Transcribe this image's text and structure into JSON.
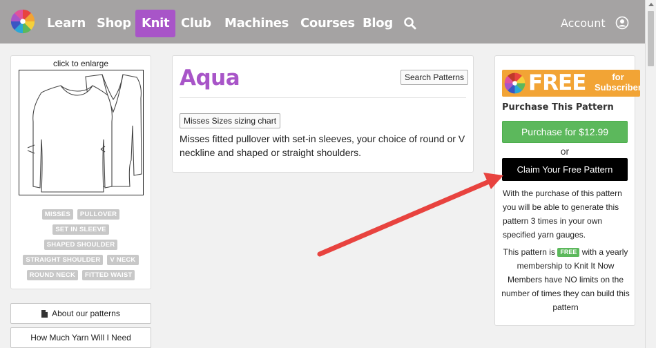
{
  "nav": {
    "items": [
      "Learn",
      "Shop",
      "Knit",
      "Club",
      "Machines",
      "Courses",
      "Blog"
    ],
    "active": "Knit",
    "account_label": "Account"
  },
  "sidebar": {
    "enlarge_label": "click to enlarge",
    "tags": [
      [
        "MISSES",
        "PULLOVER"
      ],
      [
        "SET IN SLEEVE"
      ],
      [
        "SHAPED SHOULDER"
      ],
      [
        "STRAIGHT SHOULDER",
        "V NECK"
      ],
      [
        "ROUND NECK",
        "FITTED WAIST"
      ]
    ],
    "about_label": "About our patterns",
    "yarn_label": "How Much Yarn Will I Need"
  },
  "pattern": {
    "title": "Aqua",
    "search_button": "Search Patterns",
    "sizing_button": "Misses Sizes sizing chart",
    "description": "Misses fitted pullover with set-in sleeves, your choice of round or V neckline and shaped or straight shoulders."
  },
  "purchase": {
    "banner_free": "FREE",
    "banner_for": "for",
    "banner_subscribers": "Subscribers",
    "heading": "Purchase This Pattern",
    "purchase_button": "Purchase for $12.99",
    "or_text": "or",
    "claim_button": "Claim Your Free Pattern",
    "info_text": "With the purchase of this pattern you will be able to generate this pattern 3 times in your own specified yarn gauges.",
    "info2_before": "This pattern is",
    "info2_badge": "FREE",
    "info2_after": "with a yearly membership to Knit It Now Members have NO limits on the number of times they can build this pattern"
  },
  "colors": {
    "nav_bg": "#a5a3a3",
    "accent": "#a855c8",
    "green": "#5cb85c",
    "banner_orange": "#f2a435",
    "arrow_red": "#e8433f"
  }
}
